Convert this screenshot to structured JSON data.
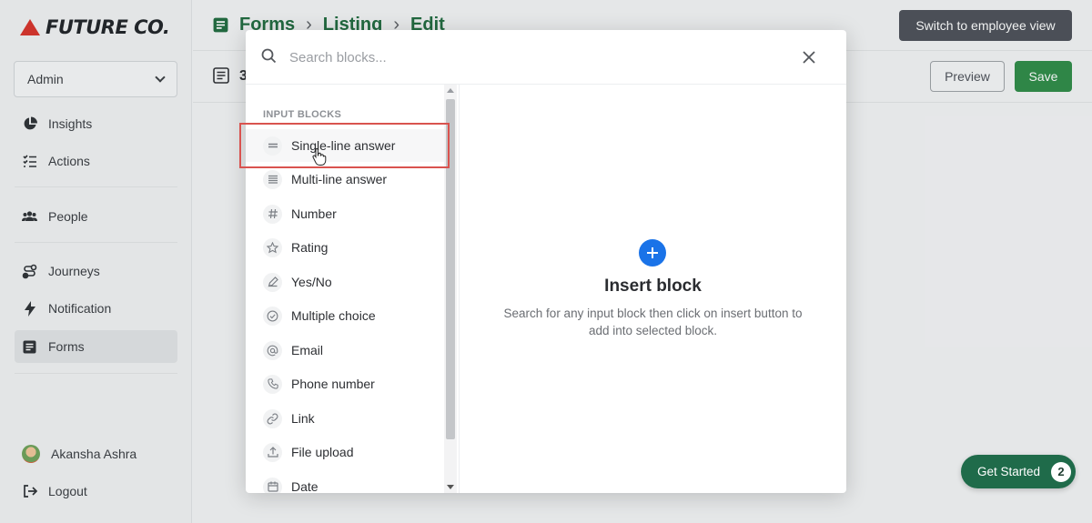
{
  "app": {
    "brand": "FUTURE CO."
  },
  "sidebar": {
    "role": "Admin",
    "items": [
      {
        "label": "Insights",
        "icon": "pie-chart-icon"
      },
      {
        "label": "Actions",
        "icon": "checklist-icon"
      },
      {
        "label": "People",
        "icon": "people-icon"
      },
      {
        "label": "Journeys",
        "icon": "journey-icon"
      },
      {
        "label": "Notification",
        "icon": "lightning-icon"
      },
      {
        "label": "Forms",
        "icon": "forms-icon",
        "active": true
      }
    ],
    "user": {
      "name": "Akansha Ashra"
    },
    "logout": "Logout"
  },
  "header": {
    "breadcrumb": [
      "Forms",
      "Listing",
      "Edit"
    ],
    "switch_view": "Switch to employee view",
    "preview": "Preview",
    "save": "Save",
    "form_title_fragment": "3"
  },
  "modal": {
    "search_placeholder": "Search blocks...",
    "section_label": "INPUT BLOCKS",
    "blocks": [
      {
        "label": "Single-line answer",
        "icon": "single-line-icon"
      },
      {
        "label": "Multi-line answer",
        "icon": "multi-line-icon"
      },
      {
        "label": "Number",
        "icon": "hash-icon"
      },
      {
        "label": "Rating",
        "icon": "star-icon"
      },
      {
        "label": "Yes/No",
        "icon": "pencil-icon"
      },
      {
        "label": "Multiple choice",
        "icon": "check-circle-icon"
      },
      {
        "label": "Email",
        "icon": "at-icon"
      },
      {
        "label": "Phone number",
        "icon": "phone-icon"
      },
      {
        "label": "Link",
        "icon": "link-icon"
      },
      {
        "label": "File upload",
        "icon": "upload-icon"
      },
      {
        "label": "Date",
        "icon": "calendar-icon"
      }
    ],
    "insert": {
      "title": "Insert block",
      "description": "Search for any input block then click on insert button to add into selected block."
    }
  },
  "get_started": {
    "label": "Get Started",
    "count": "2"
  },
  "colors": {
    "accent_green": "#2e8b47",
    "plus_blue": "#1a73e8",
    "highlight_red": "#d9534f"
  }
}
